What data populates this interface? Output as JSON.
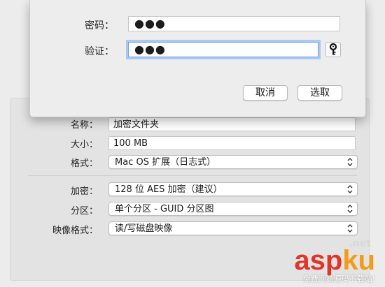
{
  "dialog": {
    "password_label": "密码：",
    "password_value": "●●●",
    "verify_label": "验证：",
    "verify_value": "●●●",
    "cancel_label": "取消",
    "choose_label": "选取"
  },
  "form": {
    "name_label": "名称：",
    "name_value": "加密文件夹",
    "size_label": "大小：",
    "size_value": "100 MB",
    "format_label": "格式：",
    "format_value": "Mac OS 扩展（日志式）",
    "encryption_label": "加密：",
    "encryption_value": "128 位 AES 加密（建议）",
    "partition_label": "分区：",
    "partition_value": "单个分区 - GUID 分区图",
    "image_format_label": "映像格式：",
    "image_format_value": "读/写磁盘映像"
  },
  "watermark": {
    "net": ".net",
    "brand_a": "asp",
    "brand_b": "ku",
    "tagline": "免费网站源码下载站!"
  },
  "colors": {
    "focus_ring": "#a9c8f3",
    "brand_red": "#e0352b",
    "brand_orange": "#f39c1a"
  }
}
